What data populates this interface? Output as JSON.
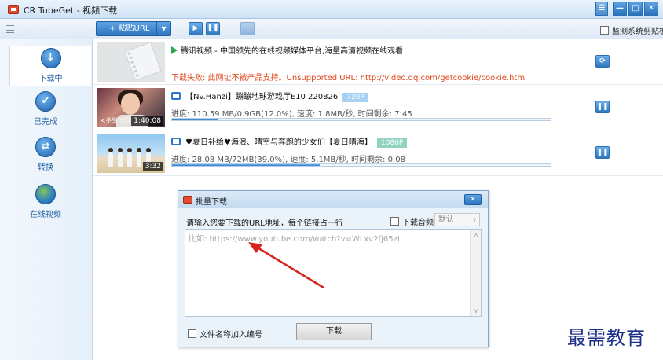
{
  "window": {
    "title": "CR TubeGet - 视频下载",
    "buttons": [
      "☰",
      "—",
      "□",
      "✕"
    ]
  },
  "toolbar": {
    "paste_label": "+ 粘贴URL",
    "paste_dropdown": "▼",
    "play_icon": "▶",
    "pause_icon": "❚❚",
    "monitor_clipboard_label": "监测系统剪贴板"
  },
  "sidebar": {
    "items": [
      {
        "label": "下载中",
        "icon": "download-icon",
        "glyph": "↓"
      },
      {
        "label": "已完成",
        "icon": "check-icon",
        "glyph": "✔"
      },
      {
        "label": "转换",
        "icon": "convert-icon",
        "glyph": "⇄"
      },
      {
        "label": "在线视频",
        "icon": "globe-icon",
        "glyph": ""
      }
    ]
  },
  "downloads": [
    {
      "title": "腾讯视频 - 中国领先的在线视频媒体平台,海量高清视频在线观看",
      "status_error": "下载失败: 此网址不被产品支持。Unsupported URL: http://video.qq.com/getcookie/cookie.html",
      "action_icon": "⟳"
    },
    {
      "title": "【Nv.Hanzi】蹦蹦地球游戏厅E10 220826",
      "quality": "720P",
      "duration": "1:40:08",
      "thumb_caption": "<우일 생각",
      "progress_text": "进度: 110.59 MB/0.9GB(12.0%), 速度: 1.8MB/秒, 时间剩余: 7:45",
      "progress": 0.12,
      "action_icon": "❚❚"
    },
    {
      "title": "♥夏日补给♥海浪、晴空与奔跑的少女们【夏日晴海】",
      "quality": "1080P",
      "duration": "3:32",
      "progress_text": "进度: 28.08 MB/72MB(39.0%), 速度: 5.1MB/秒, 时间剩余: 0:08",
      "progress": 0.39,
      "action_icon": "❚❚"
    }
  ],
  "dialog": {
    "title": "批量下载",
    "close": "✕",
    "instruction": "请输入您要下载的URL地址，每个链接占一行",
    "audio_label": "下载音频",
    "audio_select": "默认",
    "url_placeholder": "比如: https://www.youtube.com/watch?v=WLxv2fj65zI",
    "url_value": "",
    "numbering_label": "文件名称加入编号",
    "download_button": "下载"
  },
  "watermark": "最需教育",
  "colors": {
    "accent": "#2e74bf",
    "error": "#e0471c",
    "annotation_arrow": "#d8231c"
  }
}
